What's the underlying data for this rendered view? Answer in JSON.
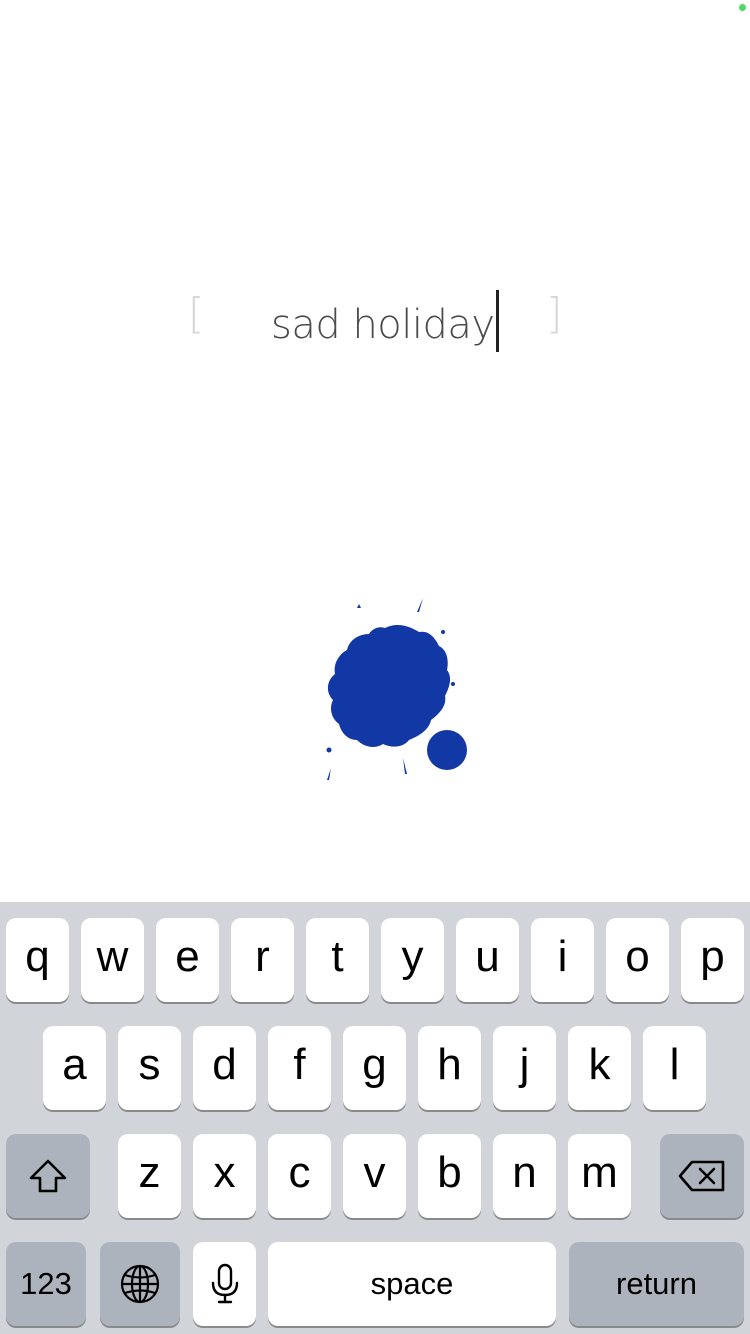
{
  "entry": {
    "text": "sad holiday",
    "bracket_open": "[",
    "bracket_close": "]"
  },
  "ink_blot": {
    "color": "#1238a6",
    "icon": "ink-blot-icon"
  },
  "keyboard": {
    "row1": [
      "q",
      "w",
      "e",
      "r",
      "t",
      "y",
      "u",
      "i",
      "o",
      "p"
    ],
    "row2": [
      "a",
      "s",
      "d",
      "f",
      "g",
      "h",
      "j",
      "k",
      "l"
    ],
    "row3": [
      "z",
      "x",
      "c",
      "v",
      "b",
      "n",
      "m"
    ],
    "shift_icon": "shift-icon",
    "delete_icon": "backspace-icon",
    "numbers_label": "123",
    "globe_icon": "globe-icon",
    "mic_icon": "microphone-icon",
    "space_label": "space",
    "return_label": "return"
  },
  "colors": {
    "accent": "#1238a6",
    "keyboard_bg": "#d1d4d9",
    "function_key": "#adb3bc",
    "status_dot": "#4cd964"
  }
}
